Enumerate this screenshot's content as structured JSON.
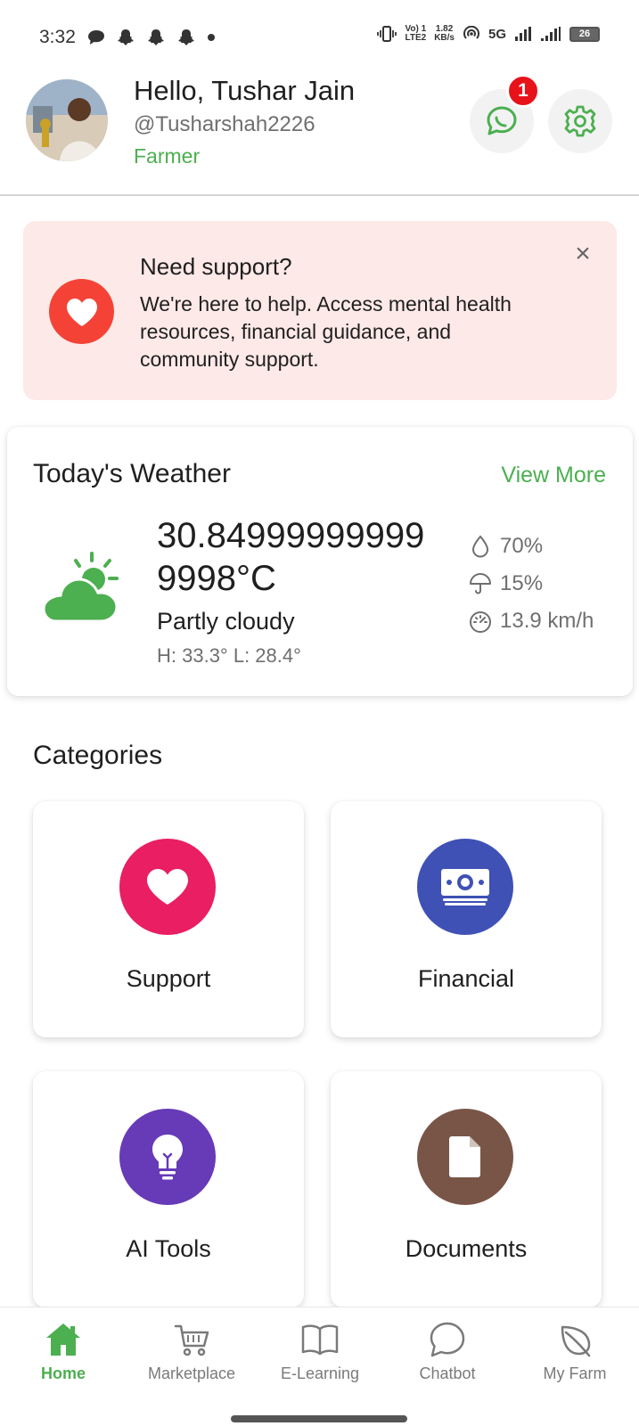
{
  "status_bar": {
    "time": "3:32",
    "network_top": "Vo) 1",
    "network_bottom": "LTE2",
    "speed_top": "1.82",
    "speed_bottom": "KB/s",
    "net_type": "5G",
    "battery": "26"
  },
  "header": {
    "greeting": "Hello, Tushar Jain",
    "username": "@Tusharshah2226",
    "role": "Farmer",
    "notification_count": "1"
  },
  "support": {
    "title": "Need support?",
    "text": "We're here to help. Access mental health resources, financial guidance, and community support.",
    "close": "×"
  },
  "weather": {
    "title": "Today's Weather",
    "view_more": "View More",
    "temperature": "30.849999999999998°C",
    "condition": "Partly cloudy",
    "high_low": "H: 33.3° L: 28.4°",
    "humidity": "70%",
    "rain_chance": "15%",
    "wind": "13.9 km/h"
  },
  "categories": {
    "title": "Categories",
    "items": [
      {
        "label": "Support",
        "color": "#e91e63"
      },
      {
        "label": "Financial",
        "color": "#3f51b5"
      },
      {
        "label": "AI Tools",
        "color": "#673ab7"
      },
      {
        "label": "Documents",
        "color": "#795548"
      }
    ]
  },
  "nav": {
    "items": [
      {
        "label": "Home"
      },
      {
        "label": "Marketplace"
      },
      {
        "label": "E-Learning"
      },
      {
        "label": "Chatbot"
      },
      {
        "label": "My Farm"
      }
    ],
    "active_color": "#4caf50"
  }
}
